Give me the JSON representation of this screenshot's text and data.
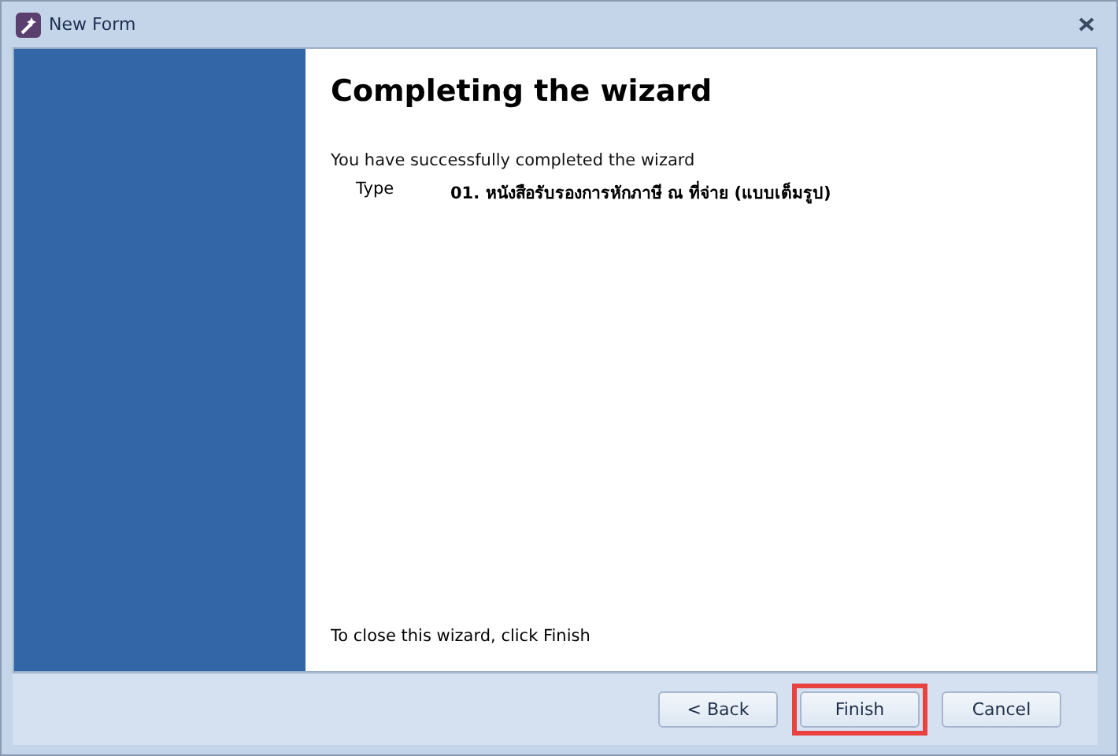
{
  "window": {
    "title": "New Form"
  },
  "wizard": {
    "heading": "Completing the wizard",
    "message": "You have successfully completed the wizard",
    "fields": [
      {
        "label": "Type",
        "value": "01. หนังสือรับรองการหักภาษี ณ ที่จ่าย (แบบเต็มรูป)"
      }
    ],
    "footer_note": "To close this wizard, click Finish"
  },
  "buttons": [
    {
      "label": "< Back",
      "highlighted": false
    },
    {
      "label": "Finish",
      "highlighted": true
    },
    {
      "label": "Cancel",
      "highlighted": false
    }
  ]
}
